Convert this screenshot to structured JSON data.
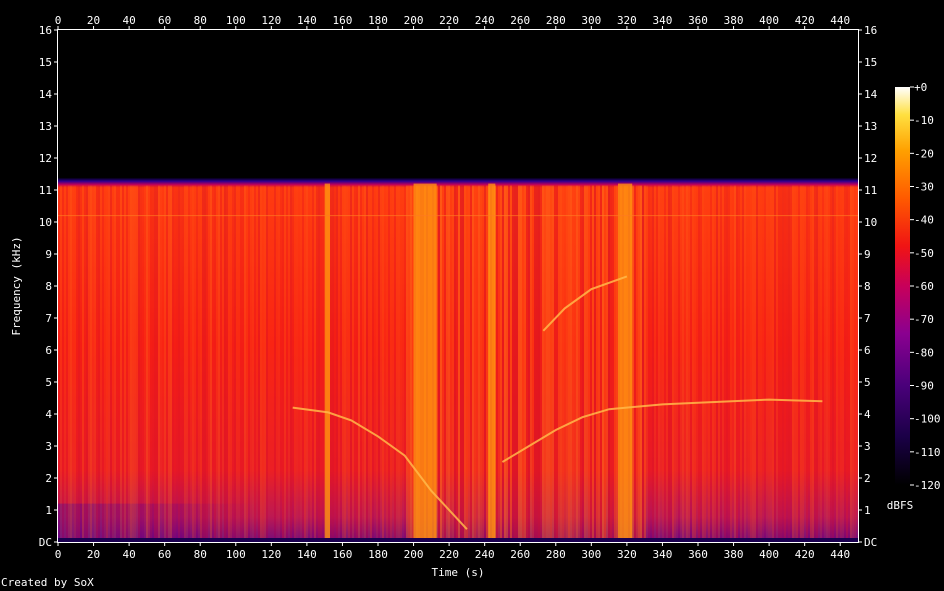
{
  "chart_data": {
    "type": "heatmap",
    "title": "",
    "xlabel": "Time (s)",
    "ylabel": "Frequency (kHz)",
    "xlim": [
      0,
      450
    ],
    "ylim": [
      0,
      16
    ],
    "x_ticks": [
      "0",
      "20",
      "40",
      "60",
      "80",
      "100",
      "120",
      "140",
      "160",
      "180",
      "200",
      "220",
      "240",
      "260",
      "280",
      "300",
      "320",
      "340",
      "360",
      "380",
      "400",
      "420",
      "440"
    ],
    "y_ticks": [
      "DC",
      "1",
      "2",
      "3",
      "4",
      "5",
      "6",
      "7",
      "8",
      "9",
      "10",
      "11",
      "12",
      "13",
      "14",
      "15",
      "16"
    ],
    "colorbar": {
      "label": "dBFS",
      "ticks": [
        "+0",
        "-10",
        "-20",
        "-30",
        "-40",
        "-50",
        "-60",
        "-70",
        "-80",
        "-90",
        "-100",
        "-110",
        "-120"
      ],
      "range": [
        -120,
        0
      ]
    },
    "regions": [
      {
        "description": "no content above cutoff",
        "freq_khz": [
          11.2,
          16
        ],
        "level_dbfs": -120
      },
      {
        "description": "broadband content",
        "freq_khz": [
          0,
          11.2
        ],
        "level_dbfs": -50
      }
    ],
    "bright_bands_s": [
      [
        150,
        153
      ],
      [
        200,
        213
      ],
      [
        242,
        246
      ],
      [
        315,
        323
      ]
    ],
    "tone_traces": [
      {
        "points": [
          [
            132,
            4.2
          ],
          [
            152,
            4.05
          ],
          [
            165,
            3.8
          ],
          [
            180,
            3.3
          ],
          [
            195,
            2.7
          ],
          [
            210,
            1.6
          ],
          [
            230,
            0.4
          ]
        ]
      },
      {
        "points": [
          [
            250,
            2.5
          ],
          [
            265,
            3.0
          ],
          [
            280,
            3.5
          ],
          [
            295,
            3.9
          ],
          [
            310,
            4.15
          ],
          [
            340,
            4.3
          ],
          [
            360,
            4.35
          ],
          [
            400,
            4.45
          ],
          [
            430,
            4.4
          ]
        ]
      },
      {
        "points": [
          [
            273,
            6.6
          ],
          [
            285,
            7.3
          ],
          [
            300,
            7.9
          ],
          [
            320,
            8.3
          ]
        ]
      }
    ],
    "steady_line_khz": 10.2
  },
  "footer": {
    "credit": "Created by SoX"
  },
  "colors": {
    "background": "#000000",
    "text": "#ffffff",
    "axis": "#ffffff"
  }
}
